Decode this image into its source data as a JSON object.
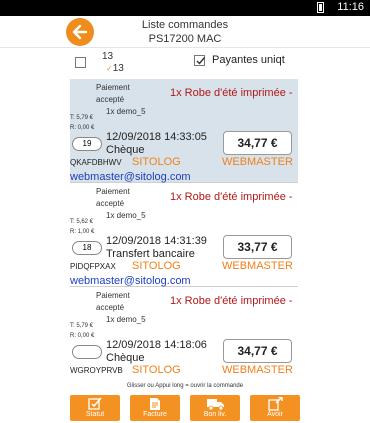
{
  "statusbar": {
    "time": "11:16"
  },
  "header": {
    "title": "Liste commandes",
    "subtitle": "PS17200 MAC"
  },
  "filter": {
    "count_total": "13",
    "count_selected": "13",
    "paid_only_label": "Payantes uniqt",
    "paid_only_checked": true
  },
  "orders": [
    {
      "status_line1": "Paiement",
      "status_line2": "accepté",
      "product": "1x Robe d'été imprimée -",
      "customer": "1x demo_5",
      "t_label": "T:  5,79 €",
      "r_label": "R:  0,00 €",
      "number": "19",
      "date": "12/09/2018 14:33:05",
      "payment": "Chèque",
      "amount": "34,77 €",
      "reference": "QKAFDBHWV",
      "shop": "SITOLOG",
      "source": "WEBMASTER",
      "email": "webmaster@sitolog.com",
      "selected": true
    },
    {
      "status_line1": "Paiement",
      "status_line2": "accepté",
      "product": "1x Robe d'été imprimée -",
      "customer": "1x demo_5",
      "t_label": "T:  5,62 €",
      "r_label": "R:  1,00 €",
      "number": "18",
      "date": "12/09/2018 14:31:39",
      "payment": "Transfert bancaire",
      "amount": "33,77 €",
      "reference": "PIDQFPXAX",
      "shop": "SITOLOG",
      "source": "WEBMASTER",
      "email": "webmaster@sitolog.com",
      "selected": false
    },
    {
      "status_line1": "Paiement",
      "status_line2": "accepté",
      "product": "1x Robe d'été imprimée -",
      "customer": "1x demo_5",
      "t_label": "T:  5,79 €",
      "r_label": "R:  0,00 €",
      "number": "",
      "date": "12/09/2018 14:18:06",
      "payment": "Chèque",
      "amount": "34,77 €",
      "reference": "WGROYPRVB",
      "shop": "SITOLOG",
      "source": "WEBMASTER",
      "email": "",
      "selected": false
    }
  ],
  "hint": "Glisser ou Appui long = ouvrir la commande",
  "toolbar": {
    "statut": "Statut",
    "facture": "Facture",
    "bonliv": "Bon liv.",
    "avoir": "Avoir"
  },
  "colors": {
    "accent": "#f39223",
    "selected_row": "#d8e2ea",
    "product_text": "#b01818",
    "link": "#1f3fbf"
  }
}
